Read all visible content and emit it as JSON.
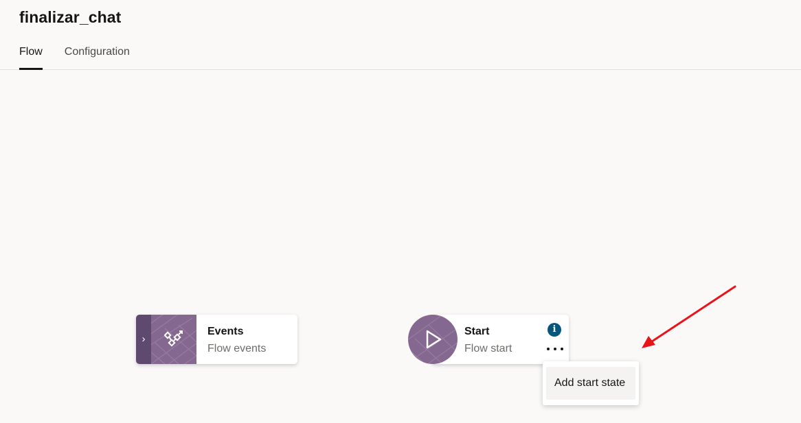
{
  "header": {
    "title": "finalizar_chat",
    "tabs": [
      {
        "label": "Flow",
        "active": true
      },
      {
        "label": "Configuration",
        "active": false
      }
    ]
  },
  "events_node": {
    "title": "Events",
    "subtitle": "Flow events",
    "toggle_glyph": "›",
    "icon": "flow-events-icon"
  },
  "start_node": {
    "title": "Start",
    "subtitle": "Flow start",
    "icon": "play-icon",
    "info_glyph": "i"
  },
  "context_menu": {
    "items": [
      {
        "label": "Add start state"
      }
    ]
  },
  "colors": {
    "node_accent": "#85688f",
    "toggle_dark": "#5e4a6e",
    "info_blue": "#04567e",
    "annotation_arrow": "#e8141a"
  }
}
